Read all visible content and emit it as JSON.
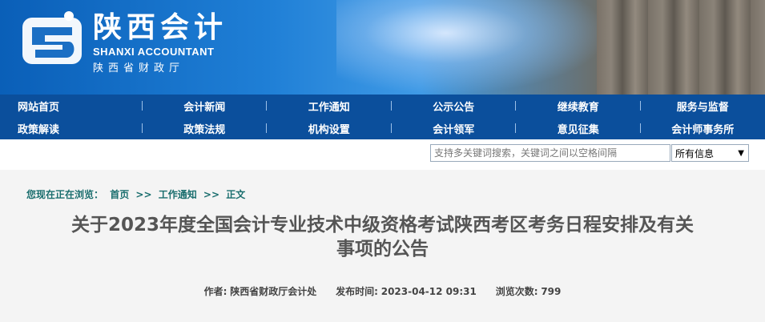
{
  "header": {
    "logo_cn": "陕西会计",
    "logo_en": "SHANXI ACCOUNTANT",
    "logo_sub": "陕西省财政厅"
  },
  "nav": {
    "row1": [
      "网站首页",
      "会计新闻",
      "工作通知",
      "公示公告",
      "继续教育",
      "服务与监督"
    ],
    "row2": [
      "政策解读",
      "政策法规",
      "机构设置",
      "会计领军",
      "意见征集",
      "会计师事务所"
    ]
  },
  "search": {
    "placeholder": "支持多关键词搜索，关键词之间以空格间隔",
    "scope": "所有信息"
  },
  "breadcrumb": {
    "prefix": "您现在正在浏览：",
    "home": "首页",
    "sep": ">>",
    "section": "工作通知",
    "current": "正文"
  },
  "article": {
    "title_line1": "关于2023年度全国会计专业技术中级资格考试陕西考区考务日程安排及有关",
    "title_line2": "事项的公告",
    "author_label": "作者:",
    "author": "陕西省财政厅会计处",
    "date_label": "发布时间:",
    "date": "2023-04-12 09:31",
    "views_label": "浏览次数:",
    "views": "799"
  }
}
